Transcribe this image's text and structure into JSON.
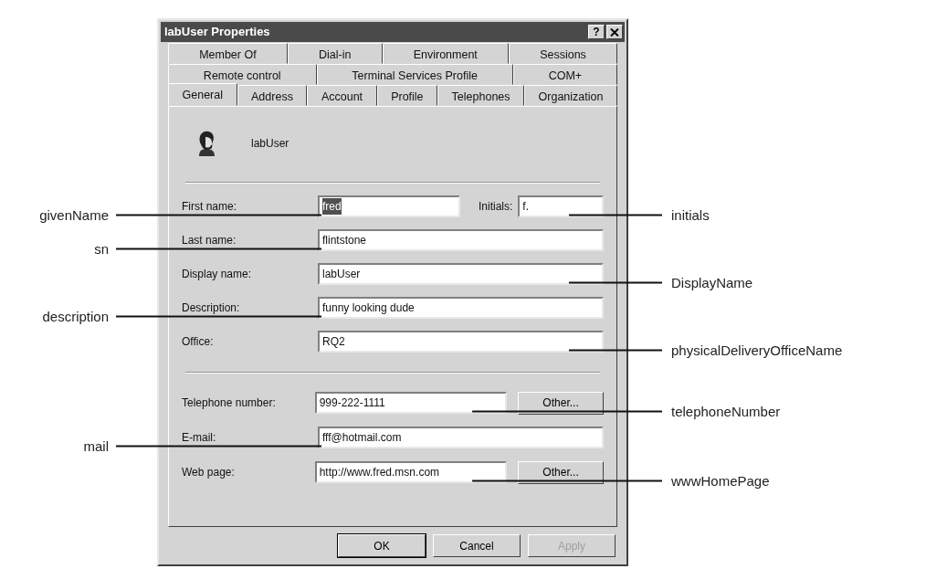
{
  "window": {
    "title": "labUser Properties",
    "help_button": "?"
  },
  "tab_rows": [
    [
      {
        "label": "Member Of",
        "selected": false
      },
      {
        "label": "Dial-in",
        "selected": false
      },
      {
        "label": "Environment",
        "selected": false
      },
      {
        "label": "Sessions",
        "selected": false
      }
    ],
    [
      {
        "label": "Remote control",
        "selected": false
      },
      {
        "label": "Terminal Services Profile",
        "selected": false
      },
      {
        "label": "COM+",
        "selected": false
      }
    ],
    [
      {
        "label": "General",
        "selected": true
      },
      {
        "label": "Address",
        "selected": false
      },
      {
        "label": "Account",
        "selected": false
      },
      {
        "label": "Profile",
        "selected": false
      },
      {
        "label": "Telephones",
        "selected": false
      },
      {
        "label": "Organization",
        "selected": false
      }
    ]
  ],
  "user": {
    "name": "labUser"
  },
  "sections": [
    [
      {
        "label": "First name:",
        "value": "fred",
        "text_selected": true,
        "left_annotation": "givenName",
        "side_field": {
          "label": "Initials:",
          "value": "f.",
          "text_selected": false,
          "right_annotation": "initials"
        }
      },
      {
        "label": "Last name:",
        "value": "flintstone",
        "text_selected": false,
        "left_annotation": "sn"
      },
      {
        "label": "Display name:",
        "value": "labUser",
        "text_selected": false,
        "right_annotation": "DisplayName"
      },
      {
        "label": "Description:",
        "value": "funny looking dude",
        "text_selected": false,
        "left_annotation": "description"
      },
      {
        "label": "Office:",
        "value": "RQ2",
        "text_selected": false,
        "right_annotation": "physicalDeliveryOfficeName"
      }
    ],
    [
      {
        "label": "Telephone number:",
        "value": "999-222-1111",
        "text_selected": false,
        "button": "Other...",
        "right_annotation": "telephoneNumber"
      },
      {
        "label": "E-mail:",
        "value": "fff@hotmail.com",
        "text_selected": false,
        "left_annotation": "mail"
      },
      {
        "label": "Web page:",
        "value": "http://www.fred.msn.com",
        "text_selected": false,
        "button": "Other...",
        "right_annotation": "wwwHomePage"
      }
    ]
  ],
  "buttons": [
    {
      "label": "OK",
      "default": true,
      "disabled": false
    },
    {
      "label": "Cancel",
      "default": false,
      "disabled": false
    },
    {
      "label": "Apply",
      "default": false,
      "disabled": true
    }
  ]
}
